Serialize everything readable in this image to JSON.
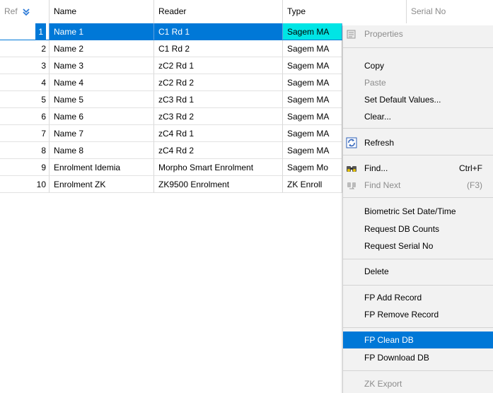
{
  "columns": [
    {
      "key": "ref",
      "label": "Ref"
    },
    {
      "key": "name",
      "label": "Name"
    },
    {
      "key": "reader",
      "label": "Reader"
    },
    {
      "key": "type",
      "label": "Type"
    },
    {
      "key": "serial",
      "label": "Serial No"
    }
  ],
  "rows": [
    {
      "ref": "1",
      "name": "Name 1",
      "reader": "C1 Rd 1",
      "type": "Sagem MA"
    },
    {
      "ref": "2",
      "name": "Name 2",
      "reader": "C1 Rd 2",
      "type": "Sagem MA"
    },
    {
      "ref": "3",
      "name": "Name 3",
      "reader": "zC2 Rd 1",
      "type": "Sagem MA"
    },
    {
      "ref": "4",
      "name": "Name 4",
      "reader": "zC2 Rd 2",
      "type": "Sagem MA"
    },
    {
      "ref": "5",
      "name": "Name 5",
      "reader": "zC3 Rd 1",
      "type": "Sagem MA"
    },
    {
      "ref": "6",
      "name": "Name 6",
      "reader": "zC3 Rd 2",
      "type": "Sagem MA"
    },
    {
      "ref": "7",
      "name": "Name 7",
      "reader": "zC4 Rd 1",
      "type": "Sagem MA"
    },
    {
      "ref": "8",
      "name": "Name 8",
      "reader": "zC4 Rd 2",
      "type": "Sagem MA"
    },
    {
      "ref": "9",
      "name": "Enrolment Idemia",
      "reader": "Morpho Smart Enrolment",
      "type": "Sagem Mo"
    },
    {
      "ref": "10",
      "name": "Enrolment ZK",
      "reader": "ZK9500 Enrolment",
      "type": "ZK Enroll"
    }
  ],
  "context_menu": {
    "properties": "Properties",
    "copy": "Copy",
    "paste": "Paste",
    "set_default": "Set Default Values...",
    "clear": "Clear...",
    "refresh": "Refresh",
    "find": "Find...",
    "find_shortcut": "Ctrl+F",
    "find_next": "Find Next",
    "find_next_shortcut": "(F3)",
    "bio_set_date": "Biometric Set Date/Time",
    "req_db_counts": "Request DB Counts",
    "req_serial": "Request Serial No",
    "delete": "Delete",
    "fp_add": "FP Add Record",
    "fp_remove": "FP Remove Record",
    "fp_clean": "FP Clean DB",
    "fp_download": "FP Download DB",
    "zk_export": "ZK Export"
  },
  "colors": {
    "selection": "#0078d7",
    "type_highlight": "#00e5e5",
    "menu_bg": "#f2f2f2"
  }
}
